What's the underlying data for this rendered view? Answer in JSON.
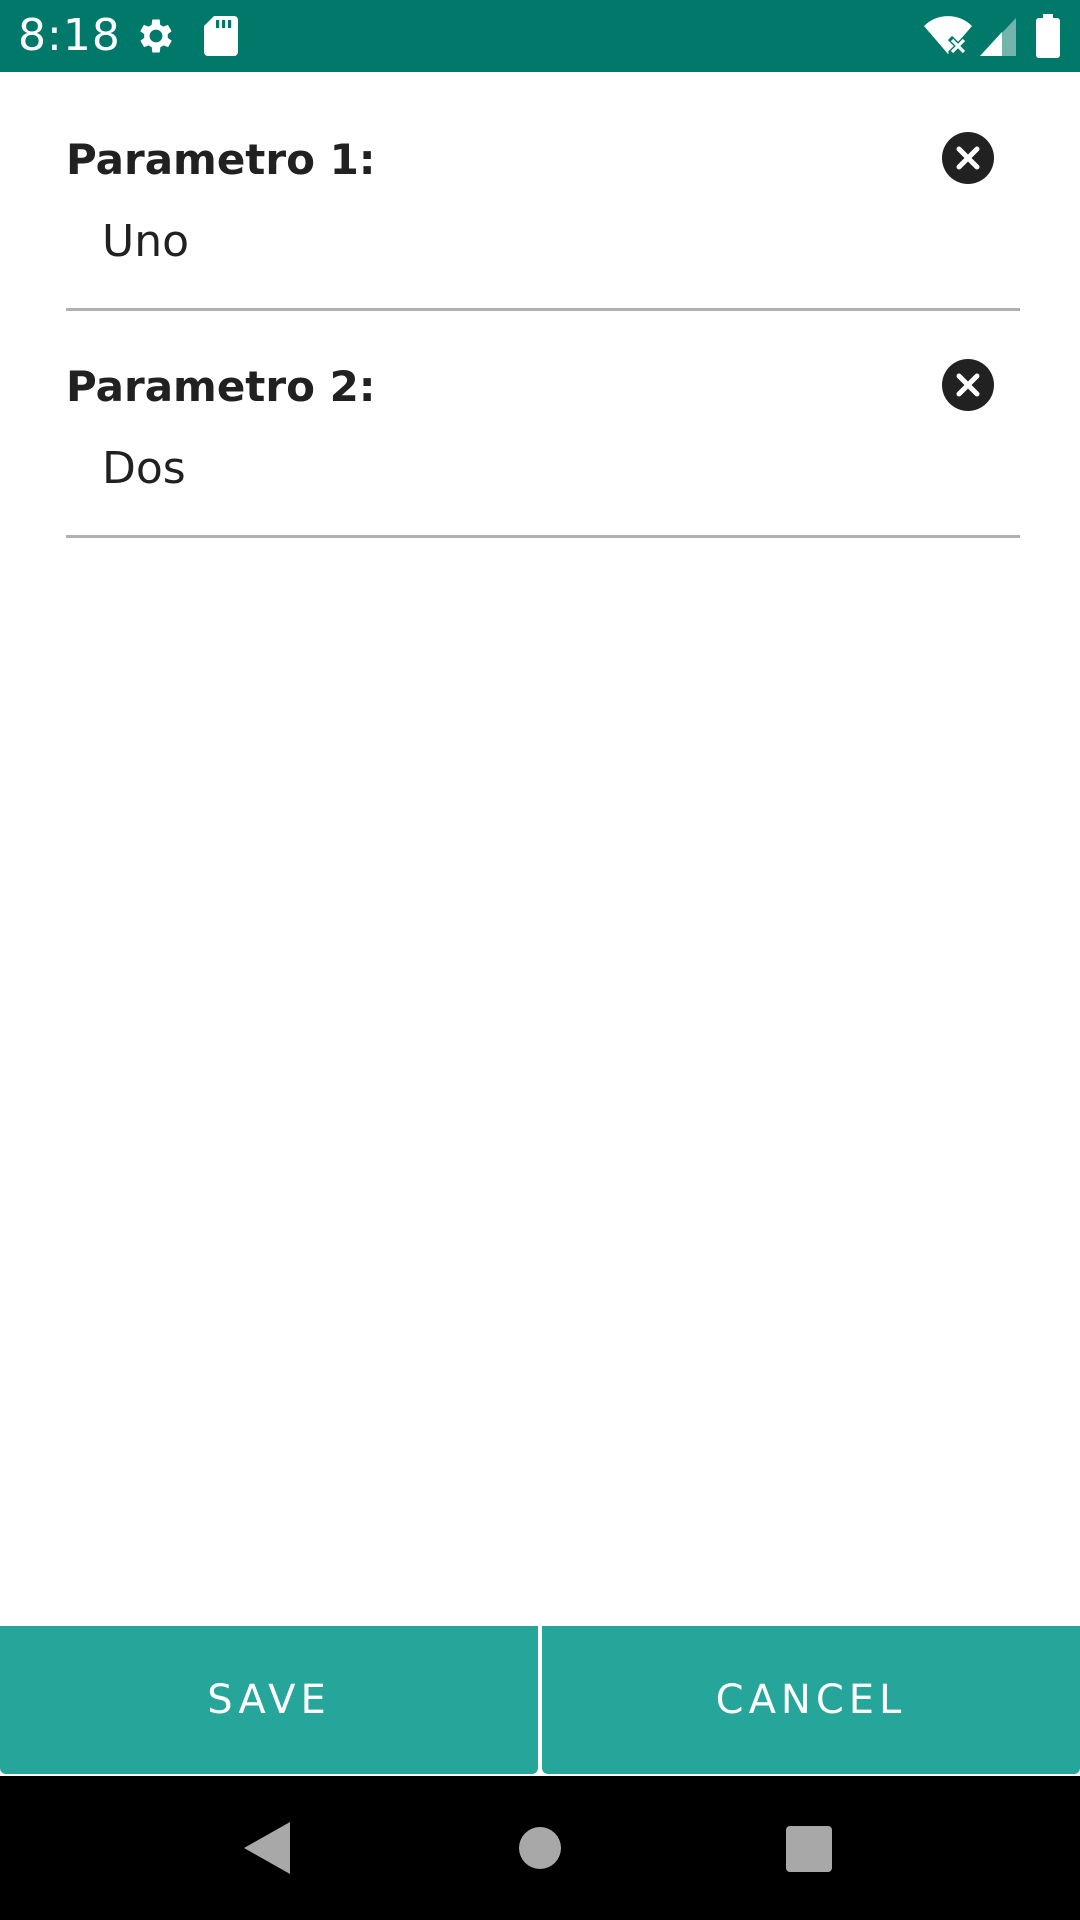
{
  "status_bar": {
    "time": "8:18",
    "background_color": "#00796b",
    "icons": [
      "settings-icon",
      "sd-card-icon",
      "wifi-off-icon",
      "cell-signal-icon",
      "battery-icon"
    ]
  },
  "params": [
    {
      "label": "Parametro 1:",
      "value": "Uno",
      "clear_icon": "clear-circle-icon"
    },
    {
      "label": "Parametro 2:",
      "value": "Dos",
      "clear_icon": "clear-circle-icon"
    }
  ],
  "actions": {
    "save_label": "SAVE",
    "cancel_label": "CANCEL",
    "button_color": "#26a69a"
  },
  "nav_bar": {
    "icons": [
      "back-icon",
      "home-icon",
      "recents-icon"
    ]
  }
}
